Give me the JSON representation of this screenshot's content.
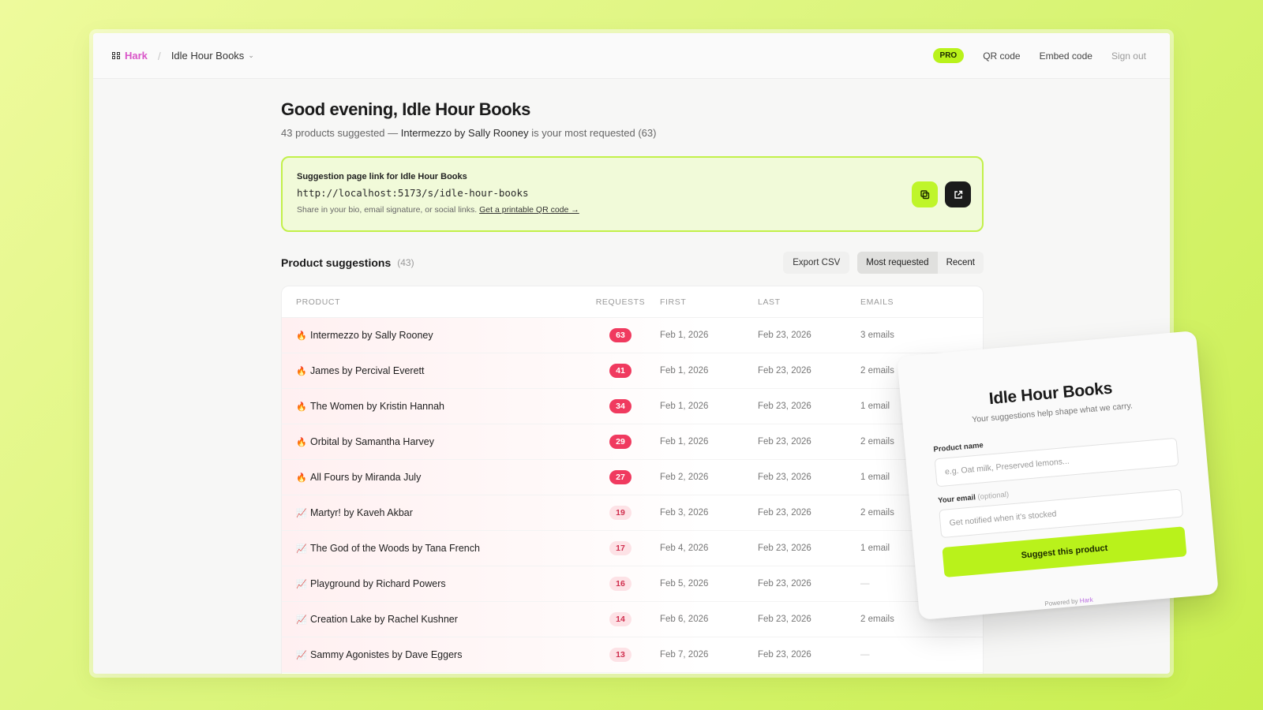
{
  "topbar": {
    "brand": "Hark",
    "shop": "Idle Hour Books",
    "pro_badge": "PRO",
    "qr_link": "QR code",
    "embed_link": "Embed code",
    "signout_link": "Sign out"
  },
  "header": {
    "greeting": "Good evening, Idle Hour Books",
    "sub_prefix": "43 products suggested — ",
    "sub_top": "Intermezzo by Sally Rooney",
    "sub_suffix": " is your most requested (63)"
  },
  "link_card": {
    "title": "Suggestion page link for Idle Hour Books",
    "url": "http://localhost:5173/s/idle-hour-books",
    "help": "Share in your bio, email signature, or social links.",
    "qr_link": "Get a printable QR code →"
  },
  "suggestions": {
    "title": "Product suggestions",
    "count": "(43)",
    "export_label": "Export CSV",
    "sort_most": "Most requested",
    "sort_recent": "Recent"
  },
  "table": {
    "columns": [
      "PRODUCT",
      "REQUESTS",
      "FIRST",
      "LAST",
      "EMAILS"
    ],
    "rows": [
      {
        "icon": "🔥",
        "product": "Intermezzo by Sally Rooney",
        "requests": "63",
        "first": "Feb 1, 2026",
        "last": "Feb 23, 2026",
        "emails": "3 emails"
      },
      {
        "icon": "🔥",
        "product": "James by Percival Everett",
        "requests": "41",
        "first": "Feb 1, 2026",
        "last": "Feb 23, 2026",
        "emails": "2 emails"
      },
      {
        "icon": "🔥",
        "product": "The Women by Kristin Hannah",
        "requests": "34",
        "first": "Feb 1, 2026",
        "last": "Feb 23, 2026",
        "emails": "1 email"
      },
      {
        "icon": "🔥",
        "product": "Orbital by Samantha Harvey",
        "requests": "29",
        "first": "Feb 1, 2026",
        "last": "Feb 23, 2026",
        "emails": "2 emails"
      },
      {
        "icon": "🔥",
        "product": "All Fours by Miranda July",
        "requests": "27",
        "first": "Feb 2, 2026",
        "last": "Feb 23, 2026",
        "emails": "1 email"
      },
      {
        "icon": "📈",
        "product": "Martyr! by Kaveh Akbar",
        "requests": "19",
        "first": "Feb 3, 2026",
        "last": "Feb 23, 2026",
        "emails": "2 emails"
      },
      {
        "icon": "📈",
        "product": "The God of the Woods by Tana French",
        "requests": "17",
        "first": "Feb 4, 2026",
        "last": "Feb 23, 2026",
        "emails": "1 email"
      },
      {
        "icon": "📈",
        "product": "Playground by Richard Powers",
        "requests": "16",
        "first": "Feb 5, 2026",
        "last": "Feb 23, 2026",
        "emails": "—"
      },
      {
        "icon": "📈",
        "product": "Creation Lake by Rachel Kushner",
        "requests": "14",
        "first": "Feb 6, 2026",
        "last": "Feb 23, 2026",
        "emails": "2 emails"
      },
      {
        "icon": "📈",
        "product": "Sammy Agonistes by Dave Eggers",
        "requests": "13",
        "first": "Feb 7, 2026",
        "last": "Feb 23, 2026",
        "emails": "—"
      }
    ]
  },
  "widget": {
    "title": "Idle Hour Books",
    "subtitle": "Your suggestions help shape what we carry.",
    "product_label": "Product name",
    "product_placeholder": "e.g. Oat milk, Preserved lemons...",
    "email_label": "Your email",
    "email_optional": "(optional)",
    "email_placeholder": "Get notified when it's stocked",
    "submit_label": "Suggest this product",
    "powered_by": "Powered by",
    "powered_brand": "Hark"
  },
  "colors": {
    "accent": "#b9f21b",
    "brand": "#d955c8",
    "hot_badge": "#f03a5f"
  }
}
